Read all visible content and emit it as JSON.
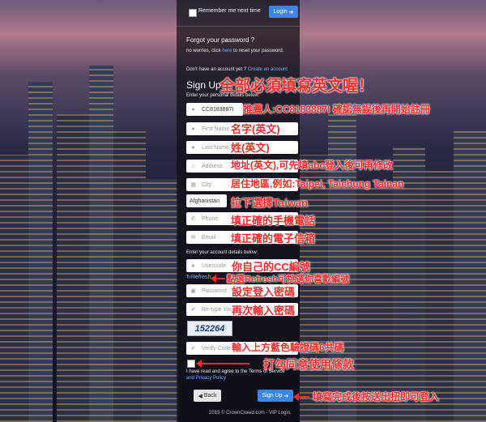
{
  "login": {
    "remember_label": "Remember me next time",
    "login_button": "Login"
  },
  "forgot": {
    "title": "Forgot your password ?",
    "text_before": "no worries, click",
    "link": "here",
    "text_after": "to reset your password."
  },
  "signup": {
    "no_account": "Don't have an account yet ?",
    "create_link": "Create an account",
    "title": "Sign Up",
    "personal_label": "Enter your personal details below:",
    "referrer_value": "CC8183887I",
    "first_name_ph": "First Name",
    "last_name_ph": "Last Name",
    "address_ph": "Address",
    "city_ph": "City",
    "country_value": "Afghanistan",
    "phone_ph": "Phone",
    "email_ph": "Email",
    "account_label": "Enter your account details below:",
    "usercode_ph": "Usercode",
    "refresh_label": "Refresh",
    "password_ph": "Password",
    "retype_ph": "Re-type Your Password",
    "captcha_code": "152264",
    "verify_ph": "Verify Code",
    "agree_text": "I have read and agree to the Terms of Service",
    "privacy_text": "and Privacy Policy",
    "back_button": "Back",
    "signup_button": "Sign Up"
  },
  "footer": "2015 © CrownCrowd.com - VIP Login.",
  "annotations": {
    "title": "全部必須填寫英文喔！",
    "referrer": "推薦人:CC8183887I 確認無誤後再開始註冊",
    "first": "名字(英文)",
    "last": "姓(英文)",
    "address": "地址(英文),可先填abc登入後可再修改",
    "city": "居住地區,例如:Taipei, Taichung Tainan",
    "country": "拉下選擇Taiwan",
    "phone": "填正確的手機電話",
    "email": "填正確的電子信箱",
    "usercode": "你自己的CC編號",
    "refresh": "點選Refresh可挑選你喜歡編號",
    "password": "設定登入密碼",
    "retype": "再次輸入密碼",
    "captcha": "輸入上方藍色驗證碼6共碼",
    "agree": "打勾同意使用條款",
    "submit": "填寫完成後按送出扭即可登入"
  },
  "icons": {
    "user": "user-icon",
    "home": "home-icon",
    "map": "map-icon",
    "phone": "phone-icon",
    "mail": "mail-icon",
    "lock": "lock-icon",
    "check": "check-icon",
    "arrow": "arrow-right-icon"
  }
}
